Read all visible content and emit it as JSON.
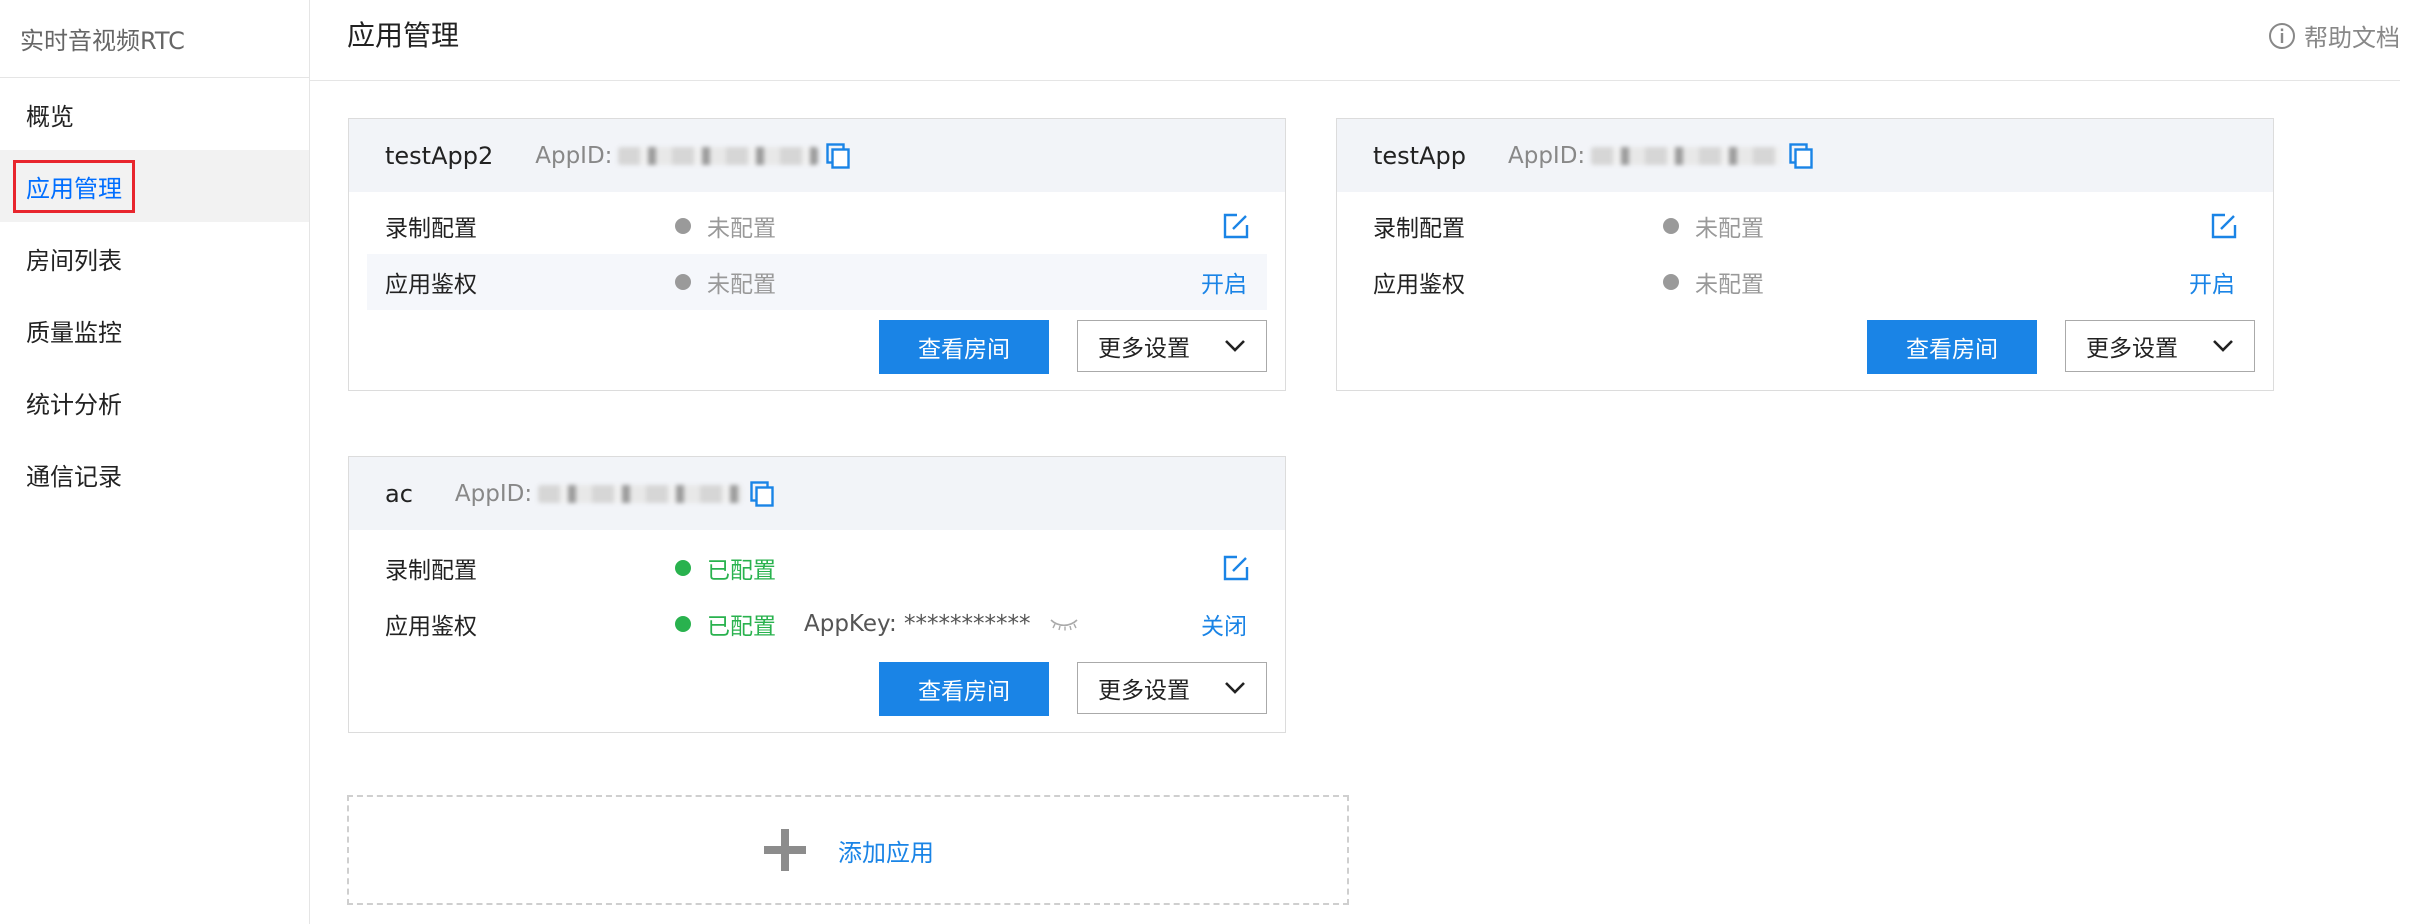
{
  "sidebar": {
    "brand": "实时音视频RTC",
    "items": [
      {
        "label": "概览"
      },
      {
        "label": "应用管理"
      },
      {
        "label": "房间列表"
      },
      {
        "label": "质量监控"
      },
      {
        "label": "统计分析"
      },
      {
        "label": "通信记录"
      }
    ]
  },
  "header": {
    "title": "应用管理",
    "help_label": "帮助文档"
  },
  "apps": [
    {
      "name": "testApp2",
      "appid_label": "AppID:",
      "rows": [
        {
          "label": "录制配置",
          "status": "未配置"
        },
        {
          "label": "应用鉴权",
          "status": "未配置",
          "action": "开启"
        }
      ],
      "view_rooms_label": "查看房间",
      "more_settings_label": "更多设置"
    },
    {
      "name": "testApp",
      "appid_label": "AppID:",
      "rows": [
        {
          "label": "录制配置",
          "status": "未配置"
        },
        {
          "label": "应用鉴权",
          "status": "未配置",
          "action": "开启"
        }
      ],
      "view_rooms_label": "查看房间",
      "more_settings_label": "更多设置"
    },
    {
      "name": "ac",
      "appid_label": "AppID:",
      "rows": [
        {
          "label": "录制配置",
          "status": "已配置"
        },
        {
          "label": "应用鉴权",
          "status": "已配置",
          "appkey": "AppKey: ***********",
          "action": "关闭"
        }
      ],
      "view_rooms_label": "查看房间",
      "more_settings_label": "更多设置"
    }
  ],
  "add_app_label": "添加应用",
  "colors": {
    "accent": "#1a84e6",
    "configured": "#29b24e",
    "unconfigured": "#9a9a9a",
    "highlight_box": "#e8262d"
  }
}
